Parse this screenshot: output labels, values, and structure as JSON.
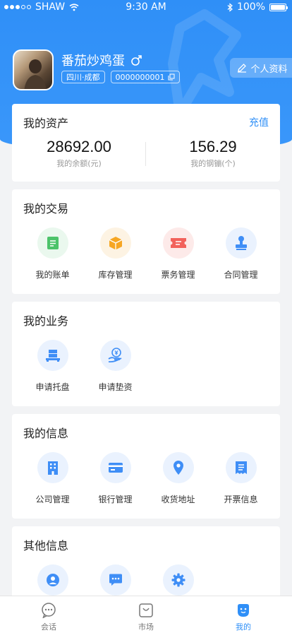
{
  "status_bar": {
    "carrier": "SHAW",
    "time": "9:30 AM",
    "battery": "100%"
  },
  "profile": {
    "name": "番茄炒鸡蛋",
    "gender_icon": "male-icon",
    "location": "四川·成都",
    "id": "0000000001",
    "edit_label": "个人资料"
  },
  "assets": {
    "title": "我的资产",
    "recharge": "充值",
    "balance_value": "28692.00",
    "balance_label": "我的余额(元)",
    "steel_value": "156.29",
    "steel_label": "我的钢镚(个)"
  },
  "trade": {
    "title": "我的交易",
    "items": [
      {
        "label": "我的账单",
        "icon": "bill-icon"
      },
      {
        "label": "库存管理",
        "icon": "box-icon"
      },
      {
        "label": "票务管理",
        "icon": "ticket-icon"
      },
      {
        "label": "合同管理",
        "icon": "stamp-icon"
      }
    ]
  },
  "business": {
    "title": "我的业务",
    "items": [
      {
        "label": "申请托盘",
        "icon": "pallet-icon"
      },
      {
        "label": "申请垫资",
        "icon": "yuan-hand-icon"
      }
    ]
  },
  "info": {
    "title": "我的信息",
    "items": [
      {
        "label": "公司管理",
        "icon": "building-icon"
      },
      {
        "label": "银行管理",
        "icon": "card-icon"
      },
      {
        "label": "收货地址",
        "icon": "location-icon"
      },
      {
        "label": "开票信息",
        "icon": "invoice-icon"
      }
    ]
  },
  "other": {
    "title": "其他信息",
    "items": [
      {
        "icon": "service-icon"
      },
      {
        "icon": "message-icon"
      },
      {
        "icon": "settings-icon"
      }
    ]
  },
  "tabbar": {
    "items": [
      {
        "label": "会话",
        "icon": "chat-icon"
      },
      {
        "label": "市场",
        "icon": "bag-icon"
      },
      {
        "label": "我的",
        "icon": "user-icon"
      }
    ]
  },
  "colors": {
    "primary": "#2f8ff7",
    "green": "#4cc36a",
    "orange": "#f6a623",
    "red": "#f2625c",
    "blue": "#3f8ef6"
  }
}
